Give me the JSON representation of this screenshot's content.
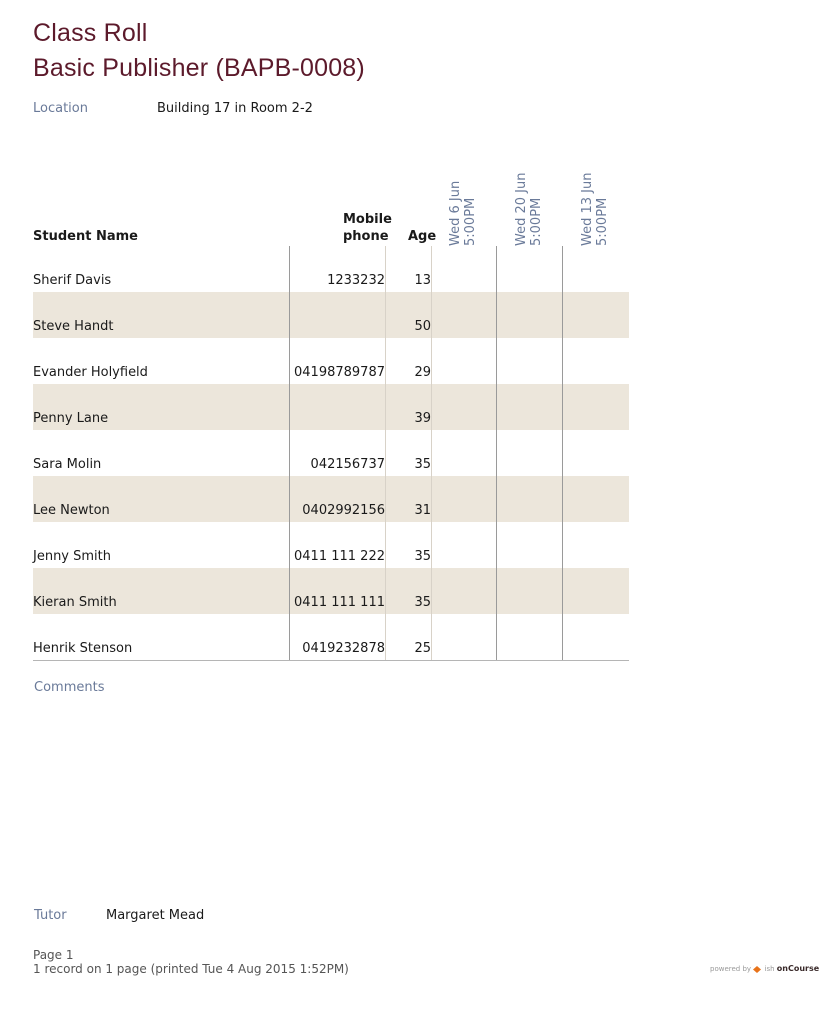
{
  "header": {
    "title": "Class Roll",
    "course": "Basic Publisher (BAPB-0008)"
  },
  "location": {
    "label": "Location",
    "value": "Building 17 in Room 2-2"
  },
  "table": {
    "columns": {
      "name": "Student Name",
      "mobile_line1": "Mobile",
      "mobile_line2": "phone",
      "age": "Age"
    },
    "sessions": [
      {
        "date": "Wed 6 Jun",
        "time": "5:00PM"
      },
      {
        "date": "Wed 20 Jun",
        "time": "5:00PM"
      },
      {
        "date": "Wed 13 Jun",
        "time": "5:00PM"
      }
    ],
    "rows": [
      {
        "name": "Sherif Davis",
        "phone": "1233232",
        "age": "13"
      },
      {
        "name": "Steve Handt",
        "phone": "",
        "age": "50"
      },
      {
        "name": "Evander Holyfield",
        "phone": "04198789787",
        "age": "29"
      },
      {
        "name": "Penny Lane",
        "phone": "",
        "age": "39"
      },
      {
        "name": "Sara Molin",
        "phone": "042156737",
        "age": "35"
      },
      {
        "name": "Lee Newton",
        "phone": "0402992156",
        "age": "31"
      },
      {
        "name": "Jenny Smith",
        "phone": "0411 111 222",
        "age": "35"
      },
      {
        "name": "Kieran Smith",
        "phone": "0411 111 111",
        "age": "35"
      },
      {
        "name": "Henrik Stenson",
        "phone": "0419232878",
        "age": "25"
      }
    ]
  },
  "comments": {
    "label": "Comments"
  },
  "tutor": {
    "label": "Tutor",
    "value": "Margaret Mead"
  },
  "footer": {
    "page": "Page 1",
    "record_info": "1 record on 1 page (printed Tue 4 Aug 2015 1:52PM)",
    "powered_by": "powered by",
    "brand_ish": "ish",
    "brand_name": "onCourse"
  },
  "colors": {
    "title": "#5c1a2b",
    "muted_label": "#6a7a99",
    "row_alt": "#ece6db"
  }
}
